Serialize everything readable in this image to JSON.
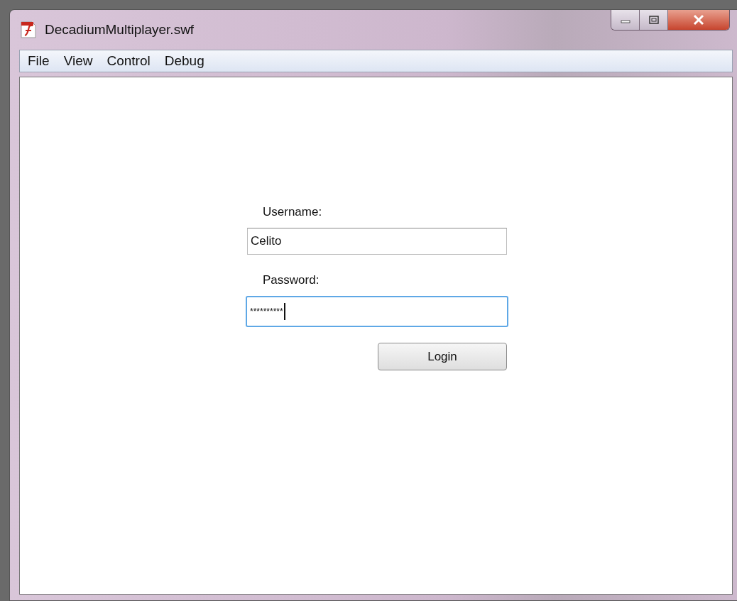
{
  "window": {
    "title": "DecadiumMultiplayer.swf"
  },
  "menu": [
    "File",
    "View",
    "Control",
    "Debug"
  ],
  "form": {
    "fields": [
      {
        "label": "Username:",
        "value": "Celito",
        "focused": false
      },
      {
        "label": "Password:",
        "value": "**********",
        "focused": true
      }
    ],
    "button": "Login"
  }
}
